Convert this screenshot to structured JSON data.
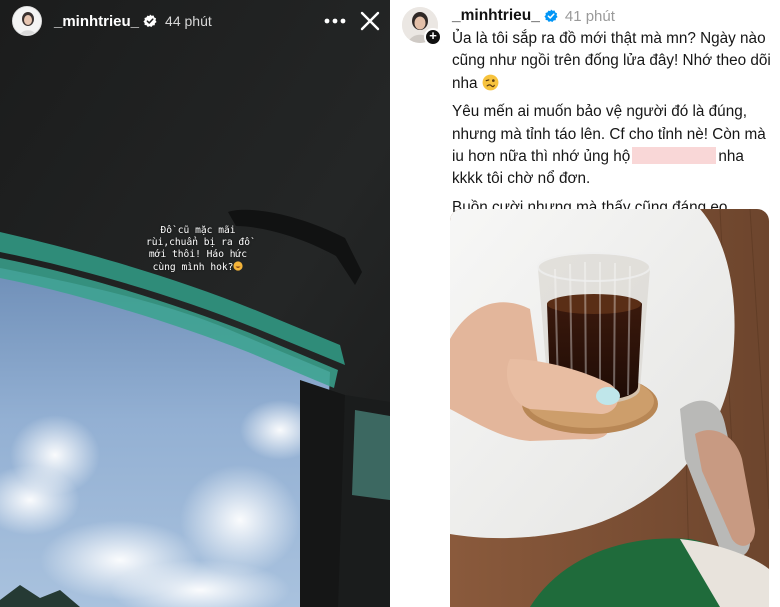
{
  "story": {
    "username": "_minhtrieu_",
    "time": "44 phút",
    "caption": "Đồ cũ mặc mãi\nrùi,chuẩn bị ra đồ\nmới thôi! Háo hức\ncùng mình hok?",
    "icons": {
      "more": "more-icon",
      "close": "close-icon",
      "verified": "verified-badge-icon"
    }
  },
  "post": {
    "username": "_minhtrieu_",
    "time": "41 phút",
    "paragraph1": "Ủa là tôi sắp ra đồ mới thật mà mn? Ngày nào cũng như ngồi trên đống lửa đây! Nhớ theo dõi nha",
    "paragraph2_before": "Yêu mến ai muốn bảo vệ người đó là đúng, nhưng mà tỉnh táo lên. Cf cho tỉnh nè! Còn mà iu hơn nữa thì nhớ ủng hộ",
    "paragraph2_after": "nha kkkk tôi chờ nổ đơn.",
    "paragraph3": "Buồn cười nhưng mà thấy cũng đáng eo.",
    "colors": {
      "verified": "#0095f6",
      "text": "#161616",
      "time": "#9a9a9a",
      "redaction": "#f9d7d7"
    }
  }
}
